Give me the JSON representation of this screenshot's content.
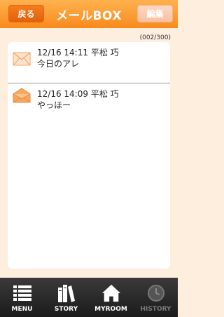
{
  "header": {
    "back_label": "戻る",
    "title": "メールBOX",
    "edit_label": "編集"
  },
  "mail_count": "(002/300)",
  "mails": [
    {
      "datetime": "12/16 14:11",
      "sender": "平松 巧",
      "subject": "今日のアレ",
      "state": "read"
    },
    {
      "datetime": "12/16 14:09",
      "sender": "平松 巧",
      "subject": "やっほー",
      "state": "unread"
    }
  ],
  "tabs": [
    {
      "label": "MENU",
      "icon": "list-icon",
      "enabled": true
    },
    {
      "label": "STORY",
      "icon": "books-icon",
      "enabled": true
    },
    {
      "label": "MYROOM",
      "icon": "house-icon",
      "enabled": true
    },
    {
      "label": "HISTORY",
      "icon": "clock-icon",
      "enabled": false
    }
  ],
  "colors": {
    "header_orange": "#f98a1e",
    "background": "#fdeede",
    "envelope_orange": "#f59a4a"
  }
}
